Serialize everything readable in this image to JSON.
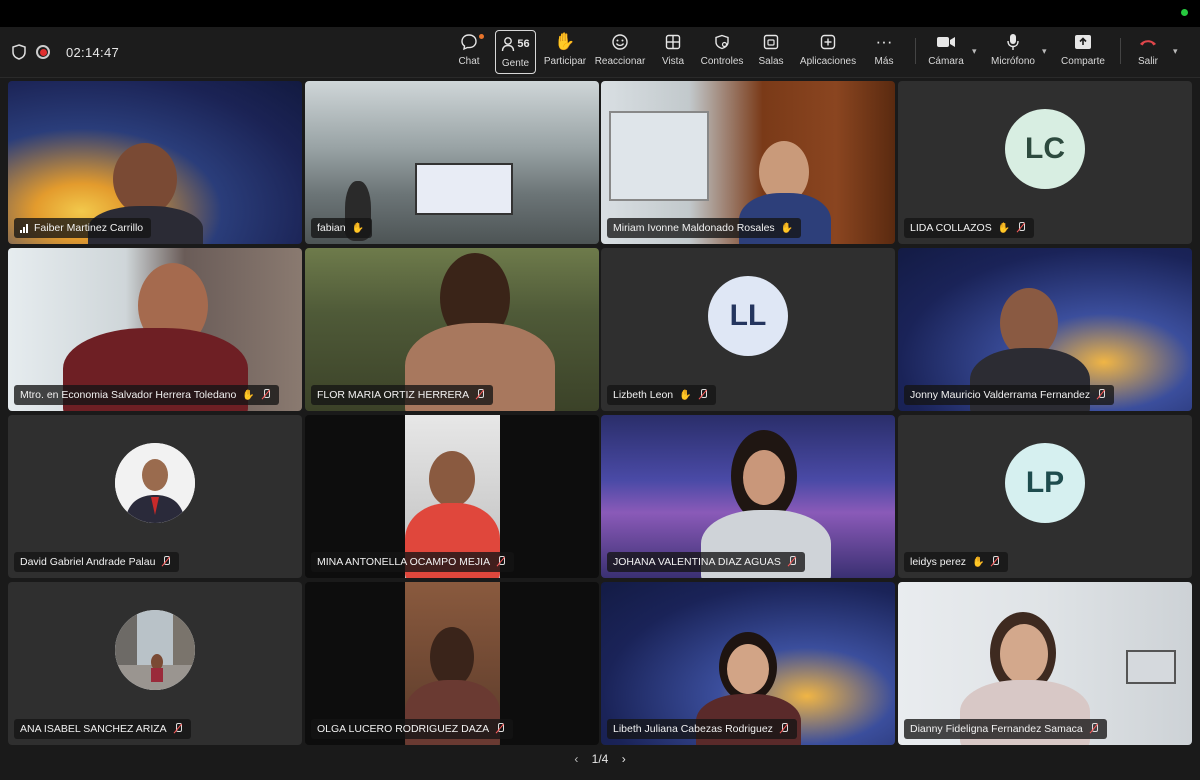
{
  "toolbar": {
    "timer": "02:14:47",
    "buttons": [
      {
        "label": "Chat",
        "icon": "chat-icon"
      },
      {
        "label": "Gente",
        "icon": "people-icon",
        "count": "56"
      },
      {
        "label": "Participar",
        "icon": "hand-icon"
      },
      {
        "label": "Reaccionar",
        "icon": "smile-icon"
      },
      {
        "label": "Vista",
        "icon": "grid-icon"
      },
      {
        "label": "Controles",
        "icon": "controls-icon"
      },
      {
        "label": "Salas",
        "icon": "rooms-icon"
      },
      {
        "label": "Aplicaciones",
        "icon": "apps-icon"
      },
      {
        "label": "Más",
        "icon": "more-icon"
      },
      {
        "label": "Cámara",
        "icon": "camera-icon"
      },
      {
        "label": "Micrófono",
        "icon": "mic-icon"
      },
      {
        "label": "Comparte",
        "icon": "share-icon"
      },
      {
        "label": "Salir",
        "icon": "leave-icon"
      }
    ]
  },
  "tiles": [
    {
      "name": "Faiber Martinez Carrillo",
      "kind": "video"
    },
    {
      "name": "fabian",
      "kind": "video"
    },
    {
      "name": "Miriam Ivonne Maldonado Rosales",
      "kind": "video"
    },
    {
      "name": "LIDA COLLAZOS",
      "kind": "initials",
      "initials": "LC"
    },
    {
      "name": "Mtro. en Economia Salvador Herrera Toledano",
      "kind": "video"
    },
    {
      "name": "FLOR MARIA ORTIZ HERRERA",
      "kind": "video"
    },
    {
      "name": "Lizbeth Leon",
      "kind": "initials",
      "initials": "LL"
    },
    {
      "name": "Jonny Mauricio Valderrama Fernandez",
      "kind": "video"
    },
    {
      "name": "David Gabriel Andrade Palau",
      "kind": "photo"
    },
    {
      "name": "MINA ANTONELLA OCAMPO MEJIA",
      "kind": "video"
    },
    {
      "name": "JOHANA VALENTINA DIAZ AGUAS",
      "kind": "video"
    },
    {
      "name": "leidys perez",
      "kind": "initials",
      "initials": "LP"
    },
    {
      "name": "ANA ISABEL SANCHEZ ARIZA",
      "kind": "photo"
    },
    {
      "name": "OLGA LUCERO RODRIGUEZ DAZA",
      "kind": "video"
    },
    {
      "name": "Libeth Juliana Cabezas Rodriguez",
      "kind": "video"
    },
    {
      "name": "Dianny Fideligna Fernandez Samaca",
      "kind": "video"
    }
  ],
  "pagination": {
    "label": "1/4"
  }
}
